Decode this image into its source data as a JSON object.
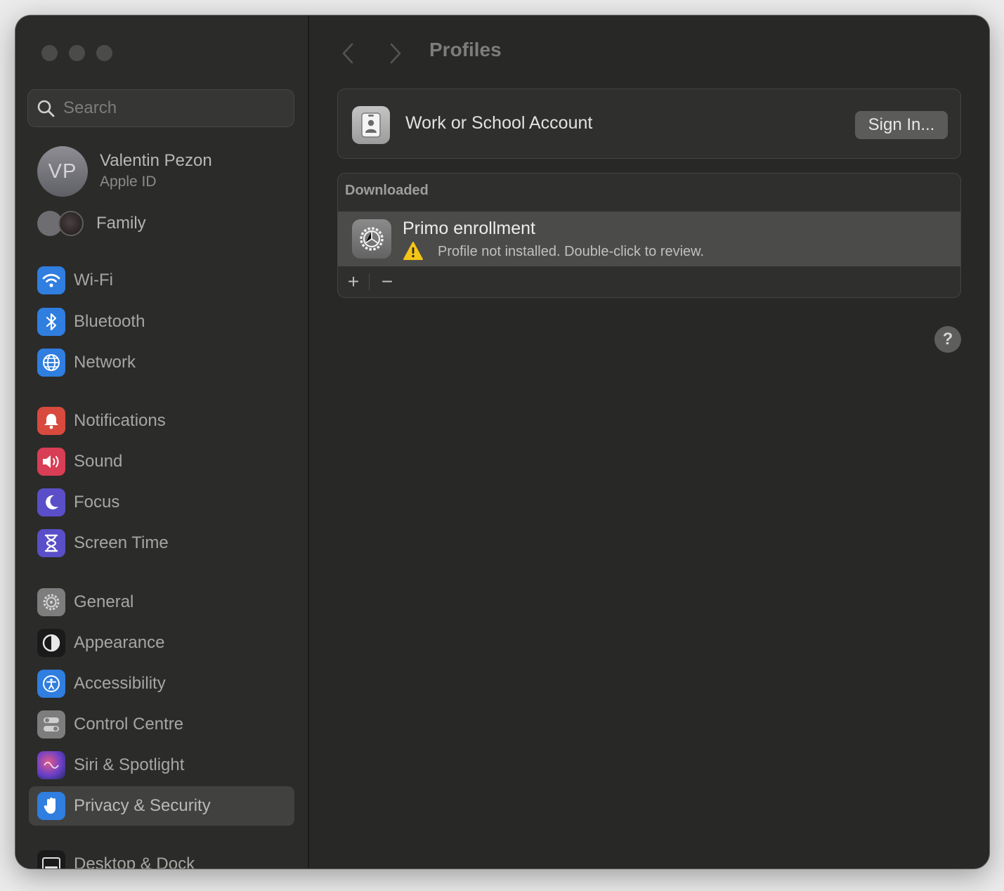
{
  "window": {
    "traffic_lights": [
      "close",
      "minimize",
      "zoom"
    ]
  },
  "sidebar": {
    "search": {
      "placeholder": "Search",
      "value": ""
    },
    "account": {
      "initials": "VP",
      "name": "Valentin Pezon",
      "subtitle": "Apple ID"
    },
    "family_label": "Family",
    "items": [
      {
        "label": "Wi-Fi",
        "icon": "wifi-icon",
        "color": "#2f7ee0"
      },
      {
        "label": "Bluetooth",
        "icon": "bluetooth-icon",
        "color": "#2f7ee0"
      },
      {
        "label": "Network",
        "icon": "globe-icon",
        "color": "#2f7ee0"
      },
      {
        "label": "Notifications",
        "icon": "bell-icon",
        "color": "#d84a3e"
      },
      {
        "label": "Sound",
        "icon": "speaker-icon",
        "color": "#d83e55"
      },
      {
        "label": "Focus",
        "icon": "moon-icon",
        "color": "#5a4fc8"
      },
      {
        "label": "Screen Time",
        "icon": "hourglass-icon",
        "color": "#5a4fc8"
      },
      {
        "label": "General",
        "icon": "gear-icon",
        "color": "#7d7d7d"
      },
      {
        "label": "Appearance",
        "icon": "appearance-icon",
        "color": "#1a1a1a"
      },
      {
        "label": "Accessibility",
        "icon": "accessibility-icon",
        "color": "#2f7ee0"
      },
      {
        "label": "Control Centre",
        "icon": "toggles-icon",
        "color": "#7d7d7d"
      },
      {
        "label": "Siri & Spotlight",
        "icon": "siri-icon",
        "color": "#8e3fb0"
      },
      {
        "label": "Privacy & Security",
        "icon": "hand-icon",
        "color": "#2f7ee0",
        "selected": true
      },
      {
        "label": "Desktop & Dock",
        "icon": "dock-icon",
        "color": "#1a1a1a"
      }
    ]
  },
  "main": {
    "title": "Profiles",
    "work_account": {
      "label": "Work or School Account",
      "button": "Sign In..."
    },
    "downloaded": {
      "header": "Downloaded",
      "profiles": [
        {
          "name": "Primo enrollment",
          "status": "Profile not installed. Double-click to review."
        }
      ],
      "add_label": "+",
      "remove_label": "−"
    },
    "help_label": "?"
  }
}
